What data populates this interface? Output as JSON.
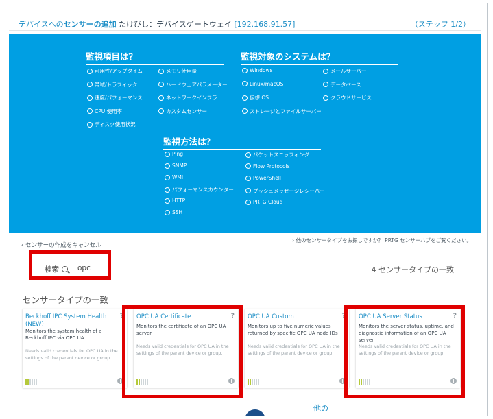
{
  "header": {
    "prefix": "デバイスへの",
    "bold": "センサーの追加",
    "host": " たけびし：デバイスゲートウェイ ",
    "ip": "[192.168.91.57]",
    "step": "（ステップ 1/2）"
  },
  "groups": {
    "what": {
      "title": "監視項目は？",
      "col1": [
        "可用性/アップタイム",
        "帯域/トラフィック",
        "速度/パフォーマンス",
        "CPU 使用率",
        "ディスク使用状況"
      ],
      "col2": [
        "メモリ使用量",
        "ハードウェアパラメーター",
        "ネットワークインフラ",
        "カスタムセンサー"
      ]
    },
    "system": {
      "title": "監視対象のシステムは？",
      "col1": [
        "Windows",
        "Linux/macOS",
        "仮想 OS",
        "ストレージとファイルサーバー"
      ],
      "col2": [
        "メールサーバー",
        "データベース",
        "クラウドサービス"
      ]
    },
    "method": {
      "title": "監視方法は？",
      "col1": [
        "Ping",
        "SNMP",
        "WMI",
        "パフォーマンスカウンター",
        "HTTP",
        "SSH"
      ],
      "col2": [
        "パケットスニッフィング",
        "Flow Protocols",
        "PowerShell",
        "プッシュメッセージレシーバー",
        "PRTG Cloud"
      ]
    }
  },
  "cancel": "‹ センサーの作成をキャンセル",
  "hub": "› 他のセンサータイプをお探しですか？ PRTG センサーハブをご覧ください。",
  "search": {
    "label": "検索",
    "value": "opc"
  },
  "count": "4 センサータイプの一致",
  "section_title": "センサータイプの一致",
  "cards": [
    {
      "title": "Beckhoff IPC System Health (NEW)",
      "desc": "Monitors the system health of a Beckhoff IPC via OPC UA",
      "note": "Needs valid credentials for OPC UA in the settings of the parent device or group.",
      "help": "?"
    },
    {
      "title": "OPC UA Certificate",
      "desc": "Monitors the certificate of an OPC UA server",
      "note": "Needs valid credentials for OPC UA in the settings of the parent device or group.",
      "help": "?"
    },
    {
      "title": "OPC UA Custom",
      "desc": "Monitors up to five numeric values returned by specific OPC UA node IDs",
      "note": "Needs valid credentials for OPC UA in the settings of the parent device or group.",
      "help": "?"
    },
    {
      "title": "OPC UA Server Status",
      "desc": "Monitors the server status, uptime, and diagnostic information of an OPC UA server",
      "note": "Needs valid credentials for OPC UA in the settings of the parent device or group.",
      "help": "?"
    }
  ],
  "more": "他の",
  "accent": "#1c8ec6",
  "panel_color": "#009fe3",
  "highlight_color": "#e00000"
}
